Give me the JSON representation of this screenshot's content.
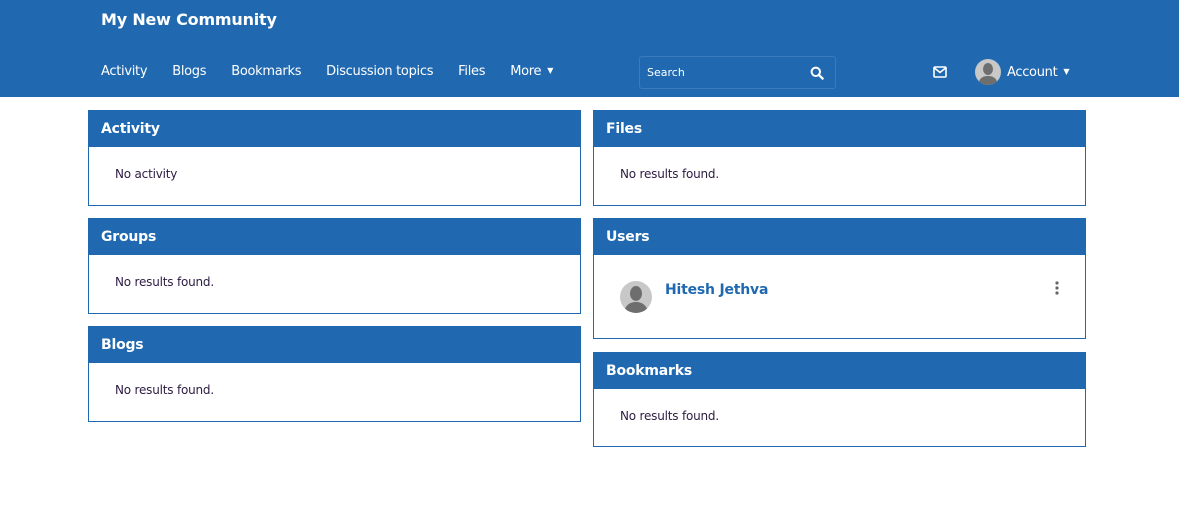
{
  "header": {
    "site_title": "My New Community",
    "nav": [
      {
        "label": "Activity"
      },
      {
        "label": "Blogs"
      },
      {
        "label": "Bookmarks"
      },
      {
        "label": "Discussion topics"
      },
      {
        "label": "Files"
      },
      {
        "label": "More",
        "icon": "chevron-down-icon"
      }
    ],
    "search": {
      "placeholder": "Search",
      "value": "",
      "icon": "search-icon"
    },
    "messages_icon": "envelope-icon",
    "account": {
      "label": "Account",
      "icon": "chevron-down-icon"
    }
  },
  "colors": {
    "brand": "#2069b0",
    "text": "#2c1b42",
    "link": "#2069b0"
  },
  "panels": {
    "activity": {
      "title": "Activity",
      "empty_text": "No activity"
    },
    "groups": {
      "title": "Groups",
      "empty_text": "No results found."
    },
    "blogs": {
      "title": "Blogs",
      "empty_text": "No results found."
    },
    "files": {
      "title": "Files",
      "empty_text": "No results found."
    },
    "users": {
      "title": "Users",
      "items": [
        {
          "name": "Hitesh Jethva",
          "menu_icon": "kebab-menu-icon"
        }
      ]
    },
    "bookmarks": {
      "title": "Bookmarks",
      "empty_text": "No results found."
    }
  }
}
